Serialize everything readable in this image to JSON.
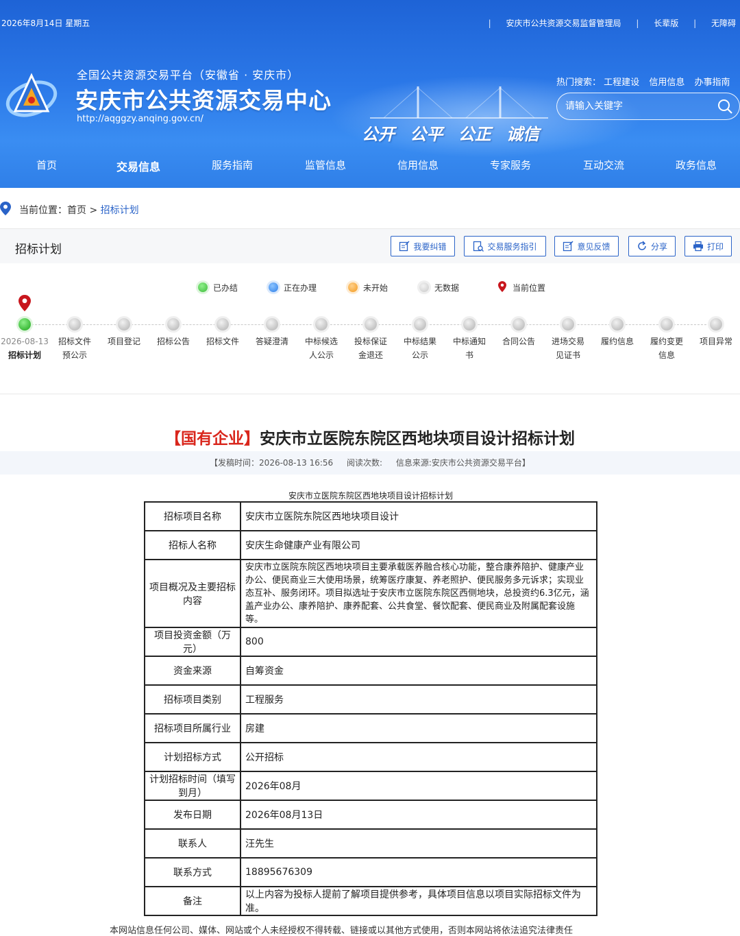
{
  "topbar": {
    "date": "2026年8月14日 星期五",
    "links": [
      "安庆市公共资源交易监督管理局",
      "长辈版",
      "无障碍"
    ]
  },
  "header": {
    "subtitle": "全国公共资源交易平台（安徽省 · 安庆市）",
    "title": "安庆市公共资源交易中心",
    "url": "http://aqggzy.anqing.gov.cn/",
    "slogan": [
      "公开",
      "公平",
      "公正",
      "诚信"
    ],
    "hot_label": "热门搜索：",
    "hot_terms": [
      "工程建设",
      "信用信息",
      "办事指南"
    ],
    "search_placeholder": "请输入关键字"
  },
  "nav": {
    "items": [
      "首页",
      "交易信息",
      "服务指南",
      "监管信息",
      "信用信息",
      "专家服务",
      "互动交流",
      "政务信息"
    ],
    "active_index": 1
  },
  "breadcrumb": {
    "label": "当前位置：",
    "home": "首页",
    "sep": ">",
    "current": "招标计划"
  },
  "panel": {
    "title": "招标计划",
    "buttons": [
      "我要纠错",
      "交易服务指引",
      "意见反馈",
      "分享",
      "打印"
    ],
    "legend": [
      {
        "label": "已办结",
        "color": "#3dbb3a"
      },
      {
        "label": "正在办理",
        "color": "#2f7fe8"
      },
      {
        "label": "未开始",
        "color": "#f39a1e"
      },
      {
        "label": "无数据",
        "color": "#c9c9c9"
      },
      {
        "label": "当前位置",
        "color": "#c8161d"
      }
    ],
    "steps": [
      {
        "label": "招标计划",
        "date": "2026-08-13",
        "done": true,
        "current": true
      },
      {
        "label": "招标文件预公示"
      },
      {
        "label": "项目登记"
      },
      {
        "label": "招标公告"
      },
      {
        "label": "招标文件"
      },
      {
        "label": "答疑澄清"
      },
      {
        "label": "中标候选人公示"
      },
      {
        "label": "投标保证金退还"
      },
      {
        "label": "中标结果公示"
      },
      {
        "label": "中标通知书"
      },
      {
        "label": "合同公告"
      },
      {
        "label": "进场交易见证书"
      },
      {
        "label": "履约信息"
      },
      {
        "label": "履约变更信息"
      },
      {
        "label": "项目异常"
      }
    ]
  },
  "article": {
    "tag": "【国有企业】",
    "title": "安庆市立医院东院区西地块项目设计招标计划",
    "meta": {
      "publish": "【发稿时间：2026-08-13 16:56",
      "reads": "阅读次数:",
      "source": "信息来源:安庆市公共资源交易平台】"
    },
    "table_caption": "安庆市立医院东院区西地块项目设计招标计划",
    "rows": [
      {
        "k": "招标项目名称",
        "v": "安庆市立医院东院区西地块项目设计"
      },
      {
        "k": "招标人名称",
        "v": "安庆生命健康产业有限公司"
      },
      {
        "k": "项目概况及主要招标内容",
        "v": "安庆市立医院东院区西地块项目主要承载医养融合核心功能，整合康养陪护、健康产业办公、便民商业三大使用场景，统筹医疗康复、养老照护、便民服务多元诉求；实现业态互补、服务闭环。项目拟选址于安庆市立医院东院区西侧地块，总投资约6.3亿元，涵盖产业办公、康养陪护、康养配套、公共食堂、餐饮配套、便民商业及附属配套设施等。"
      },
      {
        "k": "项目投资金额（万元）",
        "v": "800"
      },
      {
        "k": "资金来源",
        "v": "自筹资金"
      },
      {
        "k": "招标项目类别",
        "v": "工程服务"
      },
      {
        "k": "招标项目所属行业",
        "v": "房建"
      },
      {
        "k": "计划招标方式",
        "v": "公开招标"
      },
      {
        "k": "计划招标时间（填写到月）",
        "v": "2026年08月"
      },
      {
        "k": "发布日期",
        "v": "2026年08月13日"
      },
      {
        "k": "联系人",
        "v": "汪先生"
      },
      {
        "k": "联系方式",
        "v": "18895676309"
      },
      {
        "k": "备注",
        "v": "以上内容为投标人提前了解项目提供参考，具体项目信息以项目实际招标文件为准。"
      }
    ],
    "footer_note": "本网站信息任何公司、媒体、网站或个人未经授权不得转载、链接或以其他方式使用，否则本网站将依法追究法律责任"
  }
}
